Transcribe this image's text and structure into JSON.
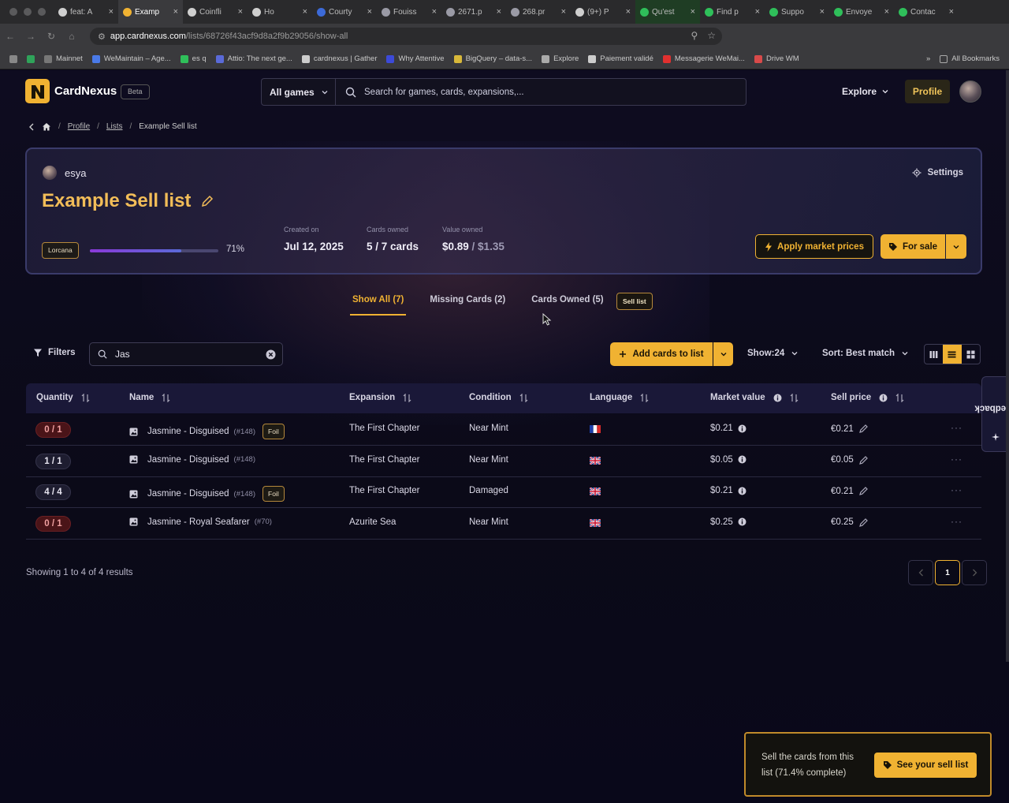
{
  "browser": {
    "tabs": [
      {
        "label": "feat: A",
        "color": "#cfcfcf"
      },
      {
        "label": "Examp",
        "color": "#f0b232",
        "active": true
      },
      {
        "label": "Coinfli",
        "color": "#cfcfcf"
      },
      {
        "label": "Ho",
        "color": "#cfcfcf"
      },
      {
        "label": "Courty",
        "color": "#3c6ad8"
      },
      {
        "label": "Fouiss",
        "color": "#9a9aa5"
      },
      {
        "label": "2671.p",
        "color": "#9a9aa5"
      },
      {
        "label": "268.pr",
        "color": "#9a9aa5"
      },
      {
        "label": "(9+) P",
        "color": "#cfcfcf"
      },
      {
        "label": "Qu'est",
        "color": "#2fbf5a"
      },
      {
        "label": "Find p",
        "color": "#2fbf5a"
      },
      {
        "label": "Suppo",
        "color": "#2fbf5a"
      },
      {
        "label": "Envoye",
        "color": "#2fbf5a"
      },
      {
        "label": "Contac",
        "color": "#2fbf5a"
      }
    ],
    "url_domain": "app.cardnexus.com",
    "url_path": "/lists/68726f43acf9d8a2f9b29056/show-all",
    "bookmarks": [
      "Mainnet",
      "WeMaintain – Age...",
      "es q",
      "Attio: The next ge...",
      "cardnexus | Gather",
      "Why Attentive",
      "BigQuery – data-s...",
      "Explore",
      "Paiement validé",
      "Messagerie WeMai...",
      "Drive WM"
    ],
    "all_bookmarks": "All Bookmarks"
  },
  "header": {
    "brand": "CardNexus",
    "beta": "Beta",
    "game_select": "All games",
    "search_placeholder": "Search for games, cards, expansions,...",
    "explore": "Explore",
    "profile": "Profile"
  },
  "breadcrumb": {
    "profile": "Profile",
    "lists": "Lists",
    "current": "Example Sell list",
    "sep": "/"
  },
  "list": {
    "owner": "esya",
    "settings": "Settings",
    "title": "Example Sell list",
    "game_chip": "Lorcana",
    "progress_pct": "71%",
    "progress_value": 0.714,
    "created_label": "Created on",
    "created_value": "Jul 12, 2025",
    "cards_owned_label": "Cards owned",
    "cards_owned_value": "5 / 7 cards",
    "value_owned_label": "Value owned",
    "value_owned_main": "$0.89",
    "value_owned_total": " / $1.35",
    "apply_prices": "Apply market prices",
    "for_sale": "For sale"
  },
  "tabs": {
    "show_all": "Show All (7)",
    "missing": "Missing Cards (2)",
    "owned": "Cards Owned (5)",
    "sell_tag": "Sell list"
  },
  "toolbar": {
    "filters": "Filters",
    "search_value": "Jas",
    "add_cards": "Add cards to list",
    "show": "Show:24",
    "sort": "Sort: Best match"
  },
  "table": {
    "headers": {
      "quantity": "Quantity",
      "name": "Name",
      "expansion": "Expansion",
      "condition": "Condition",
      "language": "Language",
      "market": "Market value",
      "sell": "Sell price"
    },
    "rows": [
      {
        "qty": "0 / 1",
        "qty_state": "red",
        "name": "Jasmine - Disguised",
        "num": "(#148)",
        "foil": "Foil",
        "expansion": "The First Chapter",
        "condition": "Near Mint",
        "lang": "fr",
        "market": "$0.21",
        "sell": "€0.21"
      },
      {
        "qty": "1 / 1",
        "qty_state": "gray",
        "name": "Jasmine - Disguised",
        "num": "(#148)",
        "foil": "",
        "expansion": "The First Chapter",
        "condition": "Near Mint",
        "lang": "gb",
        "market": "$0.05",
        "sell": "€0.05"
      },
      {
        "qty": "4 / 4",
        "qty_state": "gray",
        "name": "Jasmine - Disguised",
        "num": "(#148)",
        "foil": "Foil",
        "expansion": "The First Chapter",
        "condition": "Damaged",
        "lang": "gb",
        "market": "$0.21",
        "sell": "€0.21"
      },
      {
        "qty": "0 / 1",
        "qty_state": "red",
        "name": "Jasmine - Royal Seafarer",
        "num": "(#70)",
        "foil": "",
        "expansion": "Azurite Sea",
        "condition": "Near Mint",
        "lang": "gb",
        "market": "$0.25",
        "sell": "€0.25"
      }
    ],
    "more": "···"
  },
  "footer": {
    "showing": "Showing 1 to 4 of 4 results",
    "page": "1"
  },
  "feedback": "Feedback",
  "toast": {
    "message": "Sell the cards from this list (71.4% complete)",
    "button": "See your sell list"
  },
  "colors": {
    "accent": "#f0b232",
    "background": "#0b0a18",
    "danger": "#4a1418"
  }
}
